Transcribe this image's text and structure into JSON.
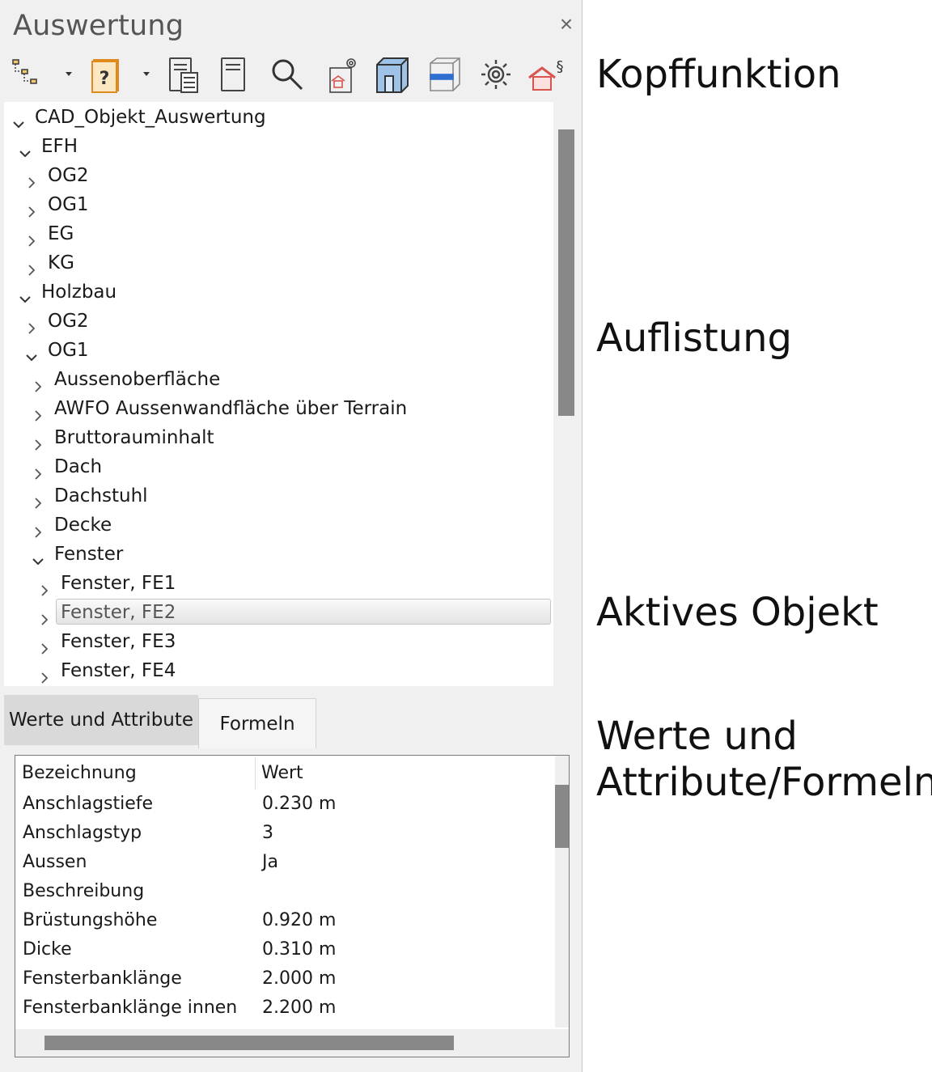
{
  "panel": {
    "title": "Auswertung",
    "close_glyph": "×",
    "toolbar": [
      {
        "name": "tree-structure-icon"
      },
      {
        "name": "dropdown-arrow-icon"
      },
      {
        "name": "help-book-icon"
      },
      {
        "name": "dropdown-arrow-icon"
      },
      {
        "name": "report-list-icon"
      },
      {
        "name": "document-icon"
      },
      {
        "name": "search-icon"
      },
      {
        "name": "house-settings-icon"
      },
      {
        "name": "room-3d-icon"
      },
      {
        "name": "layer-box-icon"
      },
      {
        "name": "gear-icon"
      },
      {
        "name": "house-paragraph-icon"
      }
    ]
  },
  "tree": {
    "items": [
      {
        "label": "CAD_Objekt_Auswertung",
        "expanded": true
      },
      {
        "label": "EFH",
        "expanded": true
      },
      {
        "label": "OG2",
        "expanded": false
      },
      {
        "label": "OG1",
        "expanded": false
      },
      {
        "label": "EG",
        "expanded": false
      },
      {
        "label": "KG",
        "expanded": false
      },
      {
        "label": "Holzbau",
        "expanded": true
      },
      {
        "label": "OG2",
        "expanded": false
      },
      {
        "label": "OG1",
        "expanded": true
      },
      {
        "label": "Aussenoberfläche",
        "expanded": false
      },
      {
        "label": "AWFO Aussenwandfläche über Terrain",
        "expanded": false
      },
      {
        "label": "Bruttorauminhalt",
        "expanded": false
      },
      {
        "label": "Dach",
        "expanded": false
      },
      {
        "label": "Dachstuhl",
        "expanded": false
      },
      {
        "label": "Decke",
        "expanded": false
      },
      {
        "label": "Fenster",
        "expanded": true
      },
      {
        "label": "Fenster, FE1",
        "expanded": false
      },
      {
        "label": "Fenster, FE2",
        "expanded": false,
        "selected": true
      },
      {
        "label": "Fenster, FE3",
        "expanded": false
      },
      {
        "label": "Fenster, FE4",
        "expanded": false
      }
    ]
  },
  "tabs": [
    {
      "label": "Werte und Attribute",
      "active": true
    },
    {
      "label": "Formeln",
      "active": false
    }
  ],
  "table": {
    "columns": [
      "Bezeichnung",
      "Wert"
    ],
    "rows": [
      [
        "Anschlagstiefe",
        "0.230 m"
      ],
      [
        "Anschlagstyp",
        "3"
      ],
      [
        "Aussen",
        "Ja"
      ],
      [
        "Beschreibung",
        ""
      ],
      [
        "Brüstungshöhe",
        "0.920 m"
      ],
      [
        "Dicke",
        "0.310 m"
      ],
      [
        "Fensterbanklänge",
        "2.000 m"
      ],
      [
        "Fensterbanklänge innen",
        "2.200 m"
      ]
    ]
  },
  "annotations": {
    "kopffunktion": "Kopffunktion",
    "auflistung": "Auflistung",
    "aktives_objekt": "Aktives Objekt",
    "werte_line1": "Werte und",
    "werte_line2": "Attribute/Formeln"
  },
  "colors": {
    "panel_bg": "#f0f0f0",
    "accent_orange": "#e08a1e",
    "accent_blue": "#2e6fd0",
    "accent_red": "#d9534f"
  }
}
